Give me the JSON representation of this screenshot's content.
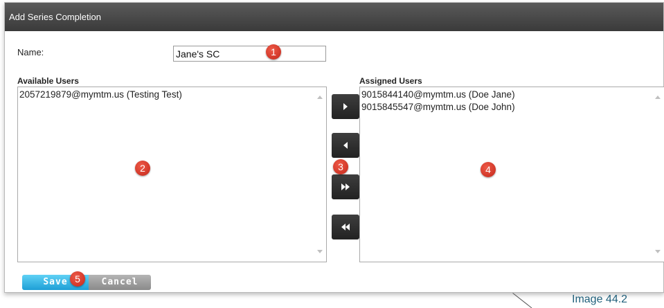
{
  "dialog": {
    "title": "Add Series Completion",
    "name_label": "Name:",
    "name_value": "Jane's SC",
    "available": {
      "label": "Available Users",
      "items": [
        "2057219879@mymtm.us (Testing Test)"
      ]
    },
    "assigned": {
      "label": "Assigned Users",
      "items": [
        "9015844140@mymtm.us (Doe Jane)",
        "9015845547@mymtm.us (Doe John)"
      ]
    },
    "buttons": {
      "save": "Save",
      "cancel": "Cancel"
    }
  },
  "badges": [
    "1",
    "2",
    "3",
    "4",
    "5"
  ],
  "caption": "Image 44.2",
  "colors": {
    "titlebar": "#3a3a3a",
    "badge": "#d83a2a",
    "save": "#1e9fd6",
    "cancel": "#8a8a8a",
    "caption": "#1f5f7a"
  },
  "icons": {
    "move_right": "caret-right-icon",
    "move_left": "caret-left-icon",
    "move_all_right": "double-chevron-right-icon",
    "move_all_left": "double-chevron-left-icon"
  }
}
